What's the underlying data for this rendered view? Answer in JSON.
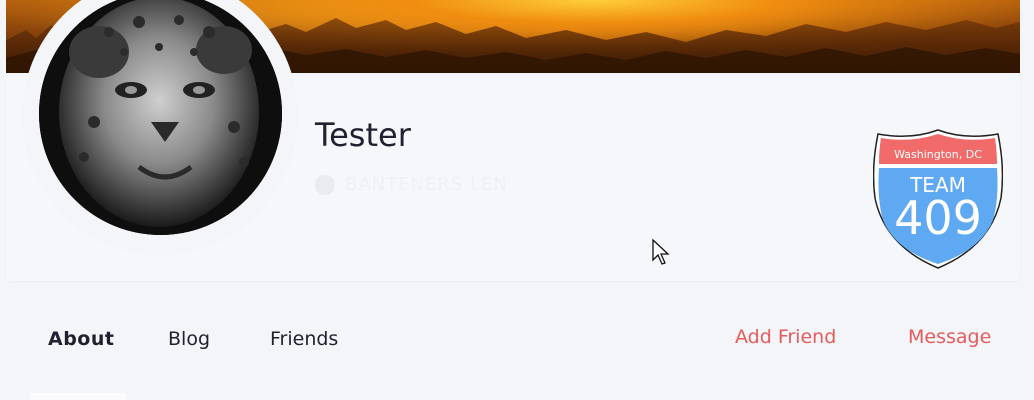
{
  "profile": {
    "username": "Tester",
    "location_faint": "BANTENERS LEN"
  },
  "badge": {
    "city": "Washington, DC",
    "team_word": "TEAM",
    "team_number": "409",
    "top_color": "#f26b6b",
    "bottom_color": "#5fa8f2"
  },
  "tabs": [
    {
      "label": "About",
      "active": true
    },
    {
      "label": "Blog",
      "active": false
    },
    {
      "label": "Friends",
      "active": false
    }
  ],
  "actions": {
    "add_friend": "Add Friend",
    "message": "Message"
  },
  "colors": {
    "accent": "#e45c5c",
    "page_bg": "#f4f5f9",
    "card_bg": "#f6f7fa"
  }
}
